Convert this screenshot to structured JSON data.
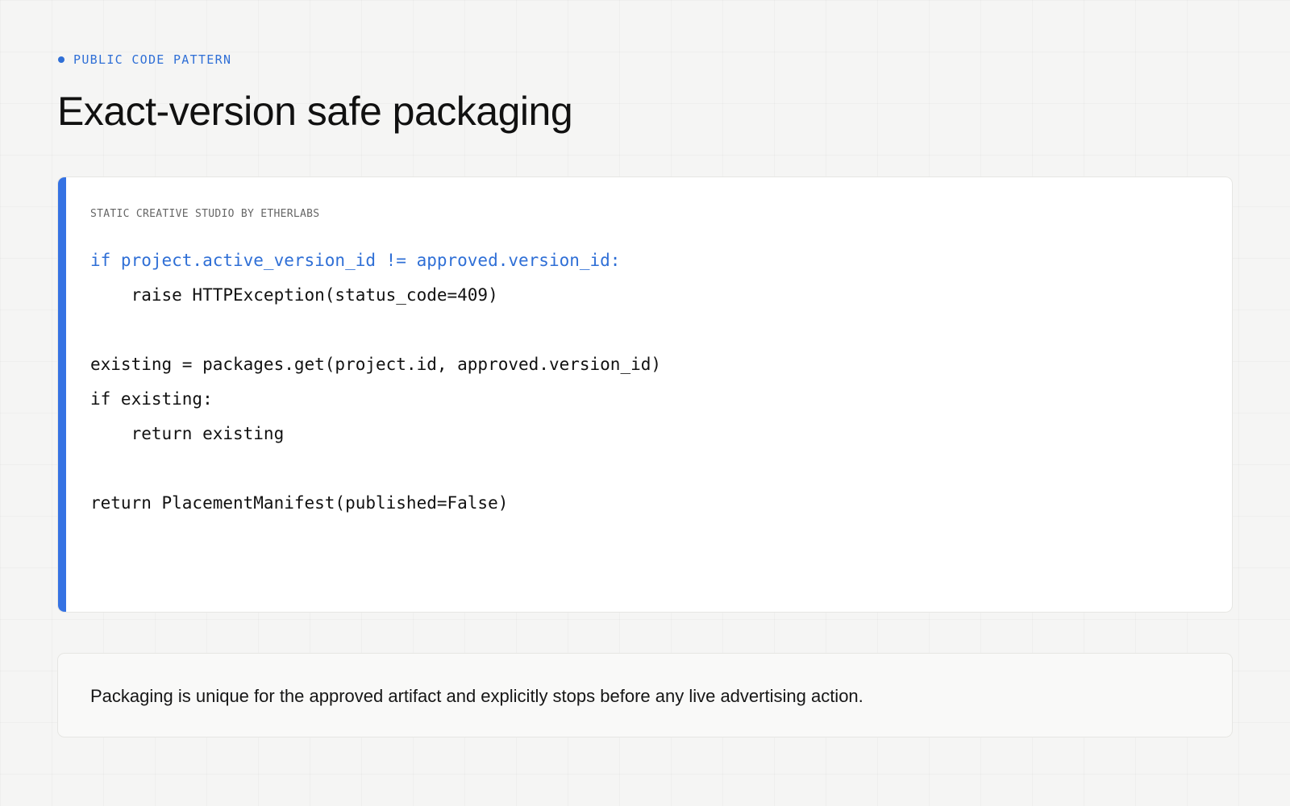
{
  "header": {
    "eyebrow": "PUBLIC CODE PATTERN",
    "title": "Exact-version safe packaging"
  },
  "code_card": {
    "label": "STATIC CREATIVE STUDIO BY ETHERLABS",
    "lines": [
      "if project.active_version_id != approved.version_id:",
      "    raise HTTPException(status_code=409)",
      "",
      "existing = packages.get(project.id, approved.version_id)",
      "if existing:",
      "    return existing",
      "",
      "return PlacementManifest(published=False)"
    ]
  },
  "note": {
    "text": "Packaging is unique for the approved artifact and explicitly stops before any live advertising action."
  },
  "colors": {
    "accent": "#3572e3",
    "eyebrow": "#2f6fd6",
    "highlight_code": "#2f6fd6",
    "background": "#f5f5f4"
  }
}
